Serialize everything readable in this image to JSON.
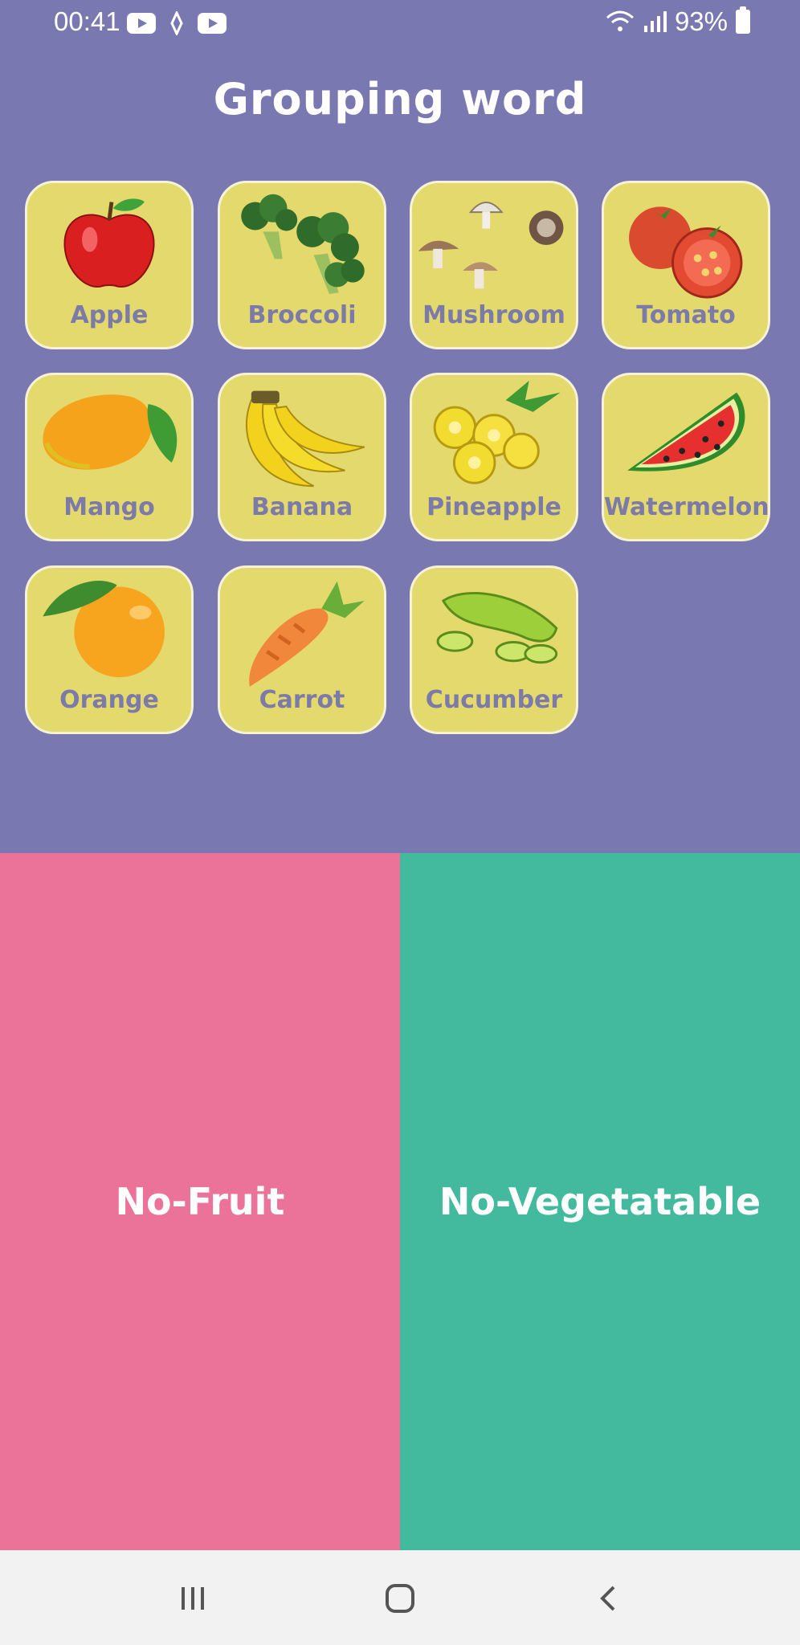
{
  "status": {
    "time": "00:41",
    "battery": "93%"
  },
  "title": "Grouping word",
  "cards": [
    {
      "label": "Apple"
    },
    {
      "label": "Broccoli"
    },
    {
      "label": "Mushroom"
    },
    {
      "label": "Tomato"
    },
    {
      "label": "Mango"
    },
    {
      "label": "Banana"
    },
    {
      "label": "Pineapple"
    },
    {
      "label": "Watermelon"
    },
    {
      "label": "Orange"
    },
    {
      "label": "Carrot"
    },
    {
      "label": "Cucumber"
    }
  ],
  "bins": {
    "fruit": "No-Fruit",
    "vegetable": "No-Vegetatable"
  },
  "colors": {
    "background": "#7a78b1",
    "card": "#e3d96d",
    "fruit_bin": "#eb7399",
    "vegetable_bin": "#43b99d",
    "label": "#7b7aa8"
  },
  "icons": [
    "youtube-icon",
    "nfc-icon",
    "wifi-icon",
    "signal-icon",
    "battery-icon",
    "recents-icon",
    "home-icon",
    "back-icon"
  ]
}
